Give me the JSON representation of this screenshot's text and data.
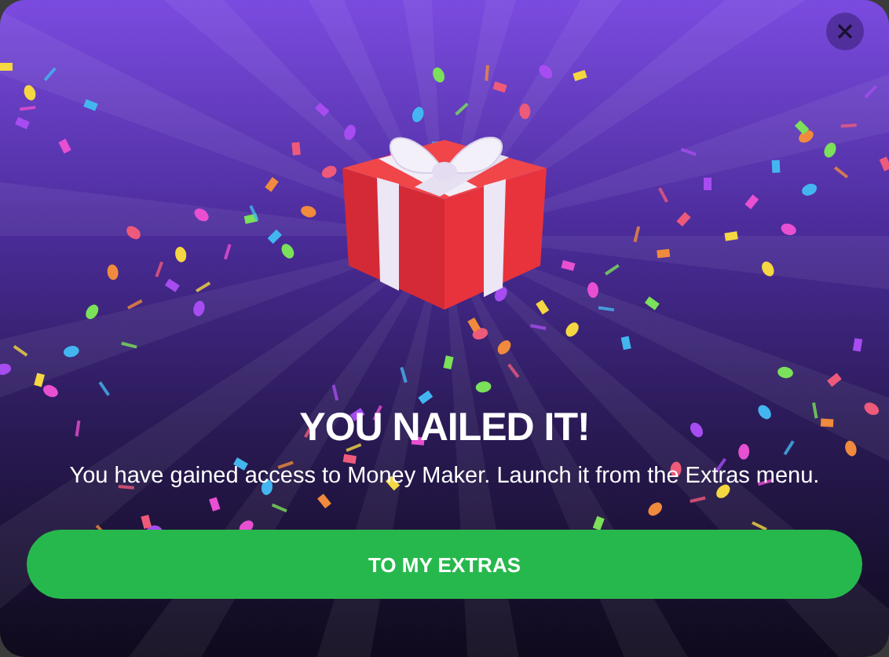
{
  "dialog": {
    "title": "YOU NAILED IT!",
    "message": "You have gained access to Money Maker. Launch it from the Extras menu.",
    "button": "TO MY EXTRAS"
  }
}
